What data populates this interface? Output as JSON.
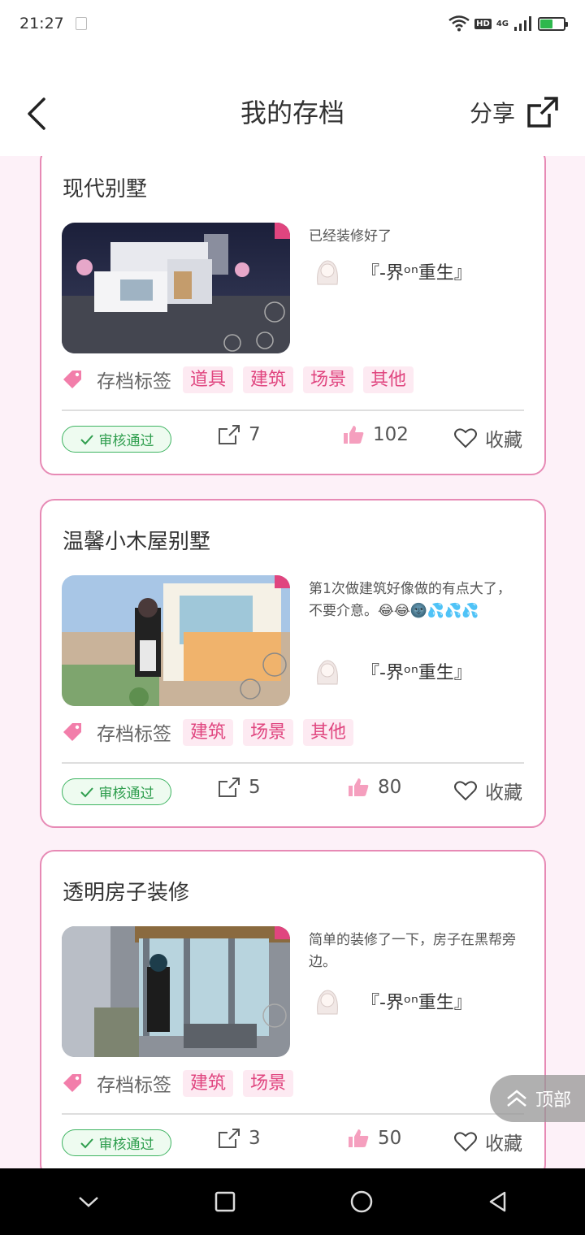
{
  "status_bar": {
    "time": "21:27",
    "hd": "HD",
    "network": "4G"
  },
  "header": {
    "title": "我的存档",
    "share_label": "分享"
  },
  "tag_section_label": "存档标签",
  "review_status": "审核通过",
  "favorite_label": "收藏",
  "to_top_label": "顶部",
  "cards": [
    {
      "title": "现代别墅",
      "description": "已经装修好了",
      "author": "『-界ᵒⁿ重生』",
      "tags": [
        "道具",
        "建筑",
        "场景",
        "其他"
      ],
      "shares": "7",
      "likes": "102"
    },
    {
      "title": "温馨小木屋别墅",
      "description": "第1次做建筑好像做的有点大了，不要介意。😂😂🌚💦💦💦",
      "author": "『-界ᵒⁿ重生』",
      "tags": [
        "建筑",
        "场景",
        "其他"
      ],
      "shares": "5",
      "likes": "80"
    },
    {
      "title": "透明房子装修",
      "description": "简单的装修了一下，房子在黑帮旁边。",
      "author": "『-界ᵒⁿ重生』",
      "tags": [
        "建筑",
        "场景"
      ],
      "shares": "3",
      "likes": "50"
    }
  ],
  "colors": {
    "accent": "#e78ab5",
    "tag_text": "#e0457f",
    "approved": "#3fb462",
    "background": "#fdf1f8"
  }
}
